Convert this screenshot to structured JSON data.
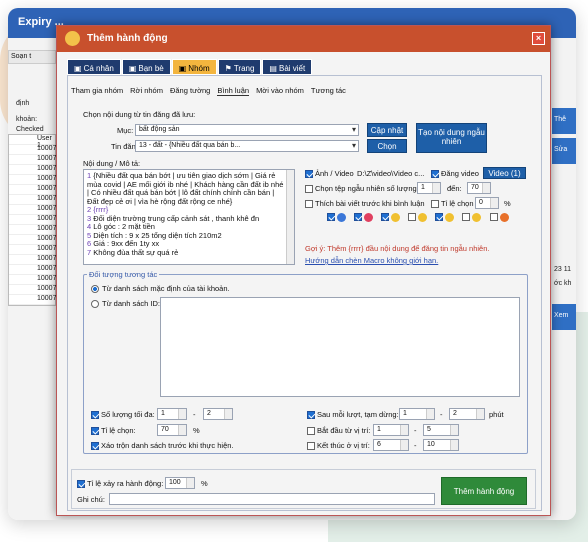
{
  "background_app": {
    "title": "Expiry ...",
    "toolbar_label": "Soạn t",
    "label1": "định",
    "label2": "khoản:",
    "checked_header": "Checked",
    "rows": [
      "User 1",
      "10007",
      "10007",
      "10007",
      "10007",
      "10007",
      "10007",
      "10007",
      "10007",
      "10007",
      "10007",
      "10007",
      "10007",
      "10007",
      "10007",
      "10007",
      "10007"
    ],
    "right_buttons": [
      "Thê",
      "Sửa",
      "Xem"
    ],
    "right_text1": "23 11",
    "right_text2": "ớc kh"
  },
  "dialog": {
    "title": "Thêm hành động",
    "close_glyph": "×",
    "tabs": [
      "Cá nhân",
      "Bạn bè",
      "Nhóm",
      "Trang",
      "Bài viết"
    ],
    "active_tab": "Nhóm",
    "subtabs": [
      "Tham gia nhóm",
      "Rời nhóm",
      "Đăng tường",
      "Bình luận",
      "Mời vào nhóm",
      "Tương tác"
    ],
    "content_label": "Chọn nội dung từ tin đăng đã lưu:",
    "muc_label": "Mục:",
    "muc_value": "bất động sản",
    "tin_dang_label": "Tin đăng:",
    "tin_dang_value": "13 - đất - {Nhiều đất qua bán b...",
    "btn_cap_nhat": "Cập nhật",
    "btn_chon": "Chọn",
    "btn_tao_noi_dung": "Tạo nội dung ngẫu nhiên",
    "noi_dung_label": "Nội dung / Mô tả:",
    "text_lines": [
      {
        "n": "1",
        "t": "{Nhiều đất qua bán bớt | ưu tiên giao dịch sớm | Giá rẻ mùa covid | AE mối giới ib nhé | Khách hàng cần đất ib nhé | Có nhiều đất quá bán bớt | lô đất chính chính cần bán | Đất đẹp cẻ ơi | vìa hè rộng đất rộng ce nhé}"
      },
      {
        "n": "2",
        "t": "{rrrr}"
      },
      {
        "n": "3",
        "t": "Đối diện trường trung cấp cảnh sát , thanh khê đn"
      },
      {
        "n": "4",
        "t": "Lô góc : 2 mặt tiền"
      },
      {
        "n": "5",
        "t": "Diện tích : 9 x 25 tổng diện tích 210m2"
      },
      {
        "n": "6",
        "t": "Giá : 9xx đến 1ty xx"
      },
      {
        "n": "7",
        "t": "Không đùa thất sự quá rẻ"
      }
    ],
    "anh_video_label": "Ảnh / Video",
    "anh_video_path": "D:\\Z\\video\\Video c...",
    "dang_video_label": "Đăng video",
    "video_btn": "Video (1)",
    "chon_tep_label": "Chọn tệp ngẫu nhiên số lượng",
    "chon_tep_from": "1",
    "den_label": "đến:",
    "chon_tep_to": "70",
    "thich_label": "Thích bài viết trước khi bình luận",
    "ti_le_chon_label": "Tỉ lệ chọn",
    "ti_le_chon_value": "0",
    "percent": "%",
    "hint": "Gợi ý: Thêm {rrrr} đầu nội dung để đăng tin ngẫu nhiên.",
    "macro_link": "Hướng dẫn chèn Macro không giới hạn.",
    "target_legend": "Đối tượng tương tác",
    "radio1": "Từ danh sách mặc định của tài khoản.",
    "radio2": "Từ danh sách ID:",
    "so_luong_toi_da": "Số lượng tối đa:",
    "sl_from": "1",
    "sl_to": "2",
    "ti_le_chon2": "Tỉ lệ chọn:",
    "ti_le_chon2_value": "70",
    "xao_tron": "Xáo trộn danh sách trước khi thực hiện.",
    "sau_moi_luot": "Sau mỗi lượt, tạm dừng:",
    "pause_from": "1",
    "pause_to": "2",
    "phut": "phút",
    "bat_dau": "Bắt đầu từ vị trí:",
    "bd_from": "1",
    "bd_to": "5",
    "ket_thuc": "Kết thúc ở vị trí:",
    "kt_from": "6",
    "kt_to": "10",
    "ti_le_xay_ra": "Tỉ lệ xảy ra hành động:",
    "ti_le_xay_ra_value": "100",
    "ghi_chu": "Ghi chú:",
    "btn_submit": "Thêm hành động",
    "dash": "-"
  }
}
